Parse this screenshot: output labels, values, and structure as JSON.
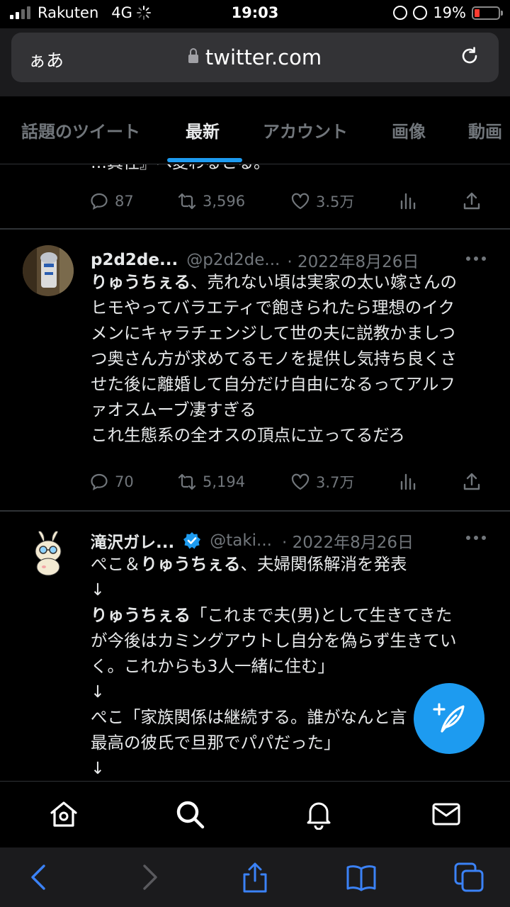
{
  "status_bar": {
    "carrier": "Rakuten",
    "network": "4G",
    "time": "19:03",
    "battery": "19%"
  },
  "browser": {
    "text_size_label": "ぁあ",
    "url": "twitter.com"
  },
  "tabs": [
    {
      "label": "話題のツイート",
      "active": false
    },
    {
      "label": "最新",
      "active": true
    },
    {
      "label": "アカウント",
      "active": false
    },
    {
      "label": "画像",
      "active": false
    },
    {
      "label": "動画",
      "active": false
    }
  ],
  "previous_tweet": {
    "cut_text": "…真性』へ変わるとる。",
    "replies": "87",
    "retweets": "3,596",
    "likes": "3.5万"
  },
  "tweets": [
    {
      "display_name": "p2d2de...",
      "handle": "@p2d2de...",
      "date": "· 2022年8月26日",
      "lines": [
        {
          "bold": "りゅうちぇる",
          "text": "、売れない頃は実家の太い嫁さんの"
        },
        {
          "bold": "",
          "text": "ヒモやってバラエティで飽きられたら理想のイク"
        },
        {
          "bold": "",
          "text": "メンにキャラチェンジして世の夫に説教かましつ"
        },
        {
          "bold": "",
          "text": "つ奥さん方が求めてるモノを提供し気持ち良くさ"
        },
        {
          "bold": "",
          "text": "せた後に離婚して自分だけ自由になるってアルフ"
        },
        {
          "bold": "",
          "text": "ァオスムーブ凄すぎる"
        },
        {
          "bold": "",
          "text": "これ生態系の全オスの頂点に立ってるだろ"
        }
      ],
      "replies": "70",
      "retweets": "5,194",
      "likes": "3.7万"
    },
    {
      "display_name": "滝沢ガレ...",
      "handle": "@taki...",
      "date": "· 2022年8月26日",
      "verified": true,
      "lines": [
        {
          "pre": "ぺこ＆",
          "bold": "りゅうちぇる",
          "text": "、夫婦関係解消を発表"
        },
        {
          "pre": "",
          "bold": "",
          "text": "↓"
        },
        {
          "pre": "",
          "bold": "りゅうちぇる",
          "text": "「これまで夫(男)として生きてきた"
        },
        {
          "pre": "",
          "bold": "",
          "text": "が今後はカミングアウトし自分を偽らず生きてい"
        },
        {
          "pre": "",
          "bold": "",
          "text": "く。これからも3人一緒に住む」"
        },
        {
          "pre": "",
          "bold": "",
          "text": "↓"
        },
        {
          "pre": "",
          "bold": "",
          "text": "ぺこ「家族関係は継続する。誰がなんと言"
        },
        {
          "pre": "",
          "bold": "",
          "text": "最高の彼氏で旦那でパパだった」"
        },
        {
          "pre": "",
          "bold": "",
          "text": "↓"
        }
      ]
    }
  ],
  "icons": {
    "bottom_nav": [
      "home-icon",
      "search-icon",
      "bell-icon",
      "mail-icon"
    ],
    "safari": [
      "back-icon",
      "forward-icon",
      "share-icon",
      "bookmarks-icon",
      "tabs-icon"
    ],
    "compose": "compose-tweet-icon"
  },
  "colors": {
    "accent": "#1d9bf0",
    "background": "#000000",
    "muted": "#71767b"
  }
}
